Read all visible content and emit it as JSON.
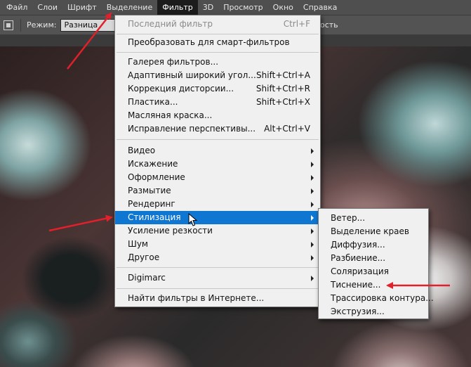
{
  "menubar": {
    "items": [
      "Файл",
      "Слои",
      "Шрифт",
      "Выделение",
      "Фильтр",
      "3D",
      "Просмотр",
      "Окно",
      "Справка"
    ],
    "active_index": 4
  },
  "options": {
    "mode_label": "Режим:",
    "mode_value": "Разница",
    "tail_text": "ость"
  },
  "filter_menu": {
    "last_filter": {
      "label": "Последний фильтр",
      "shortcut": "Ctrl+F"
    },
    "smart": "Преобразовать для смарт-фильтров",
    "gallery": {
      "label": "Галерея фильтров..."
    },
    "adaptive": {
      "label": "Адаптивный широкий угол...",
      "shortcut": "Shift+Ctrl+A"
    },
    "lens": {
      "label": "Коррекция дисторсии...",
      "shortcut": "Shift+Ctrl+R"
    },
    "liquify": {
      "label": "Пластика...",
      "shortcut": "Shift+Ctrl+X"
    },
    "oil": {
      "label": "Масляная краска..."
    },
    "vanishing": {
      "label": "Исправление перспективы...",
      "shortcut": "Alt+Ctrl+V"
    },
    "video": "Видео",
    "distort": "Искажение",
    "pixelate": "Оформление",
    "blur": "Размытие",
    "render": "Рендеринг",
    "stylize": "Стилизация",
    "sharpen": "Усиление резкости",
    "noise": "Шум",
    "other": "Другое",
    "digimarc": "Digimarc",
    "browse": "Найти фильтры в Интернете..."
  },
  "stylize_submenu": {
    "items": [
      "Ветер...",
      "Выделение краев",
      "Диффузия...",
      "Разбиение...",
      "Соляризация",
      "Тиснение...",
      "Трассировка контура...",
      "Экструзия..."
    ]
  },
  "colors": {
    "highlight": "#0f76d2",
    "annotation_arrow": "#e0202a",
    "menu_bg": "#f0f0f0",
    "menubar_bg": "#4f4f4f"
  }
}
